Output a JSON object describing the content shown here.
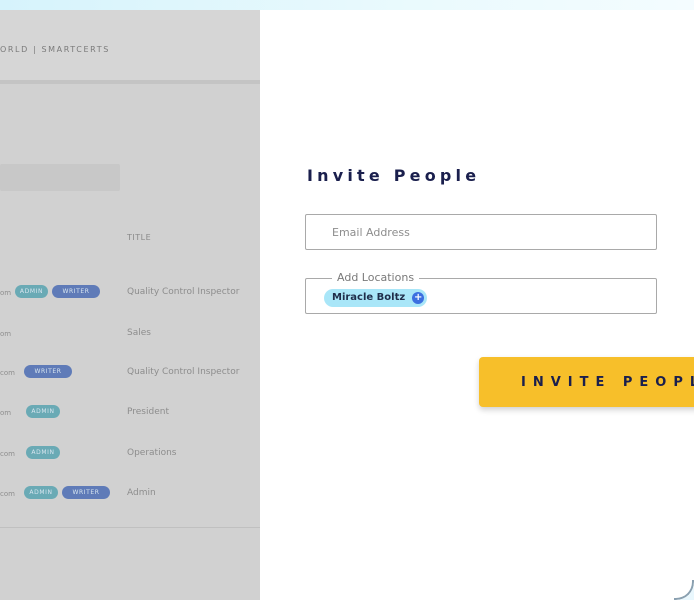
{
  "background": {
    "breadcrumb": "ORLD  |  SMARTCERTS",
    "column_title": "TITLE",
    "rows": [
      {
        "email": "om",
        "badges": [
          "ADMIN",
          "WRITER"
        ],
        "title": "Quality Control Inspector"
      },
      {
        "email": "om",
        "badges": [],
        "title": "Sales"
      },
      {
        "email": "com",
        "badges": [
          "WRITER"
        ],
        "title": "Quality Control Inspector"
      },
      {
        "email": "om",
        "badges": [
          "ADMIN"
        ],
        "title": "President"
      },
      {
        "email": "com",
        "badges": [
          "ADMIN"
        ],
        "title": "Operations"
      },
      {
        "email": "com",
        "badges": [
          "ADMIN",
          "WRITER"
        ],
        "title": "Admin"
      }
    ]
  },
  "modal": {
    "title": "Invite People",
    "email_placeholder": "Email Address",
    "locations_label": "Add Locations",
    "location_chip": "Miracle Boltz",
    "invite_button": "INVITE PEOPLE"
  },
  "colors": {
    "accent_button": "#f7bf2a",
    "chip": "#a9e6f8",
    "title": "#1a1f4d"
  }
}
